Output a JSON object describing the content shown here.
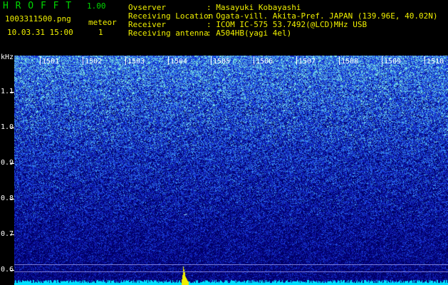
{
  "header": {
    "app_title": "H R O F F T",
    "version": "1.00",
    "filename": "1003311500.png",
    "datetime": "10.03.31 15:00",
    "meteor_label": "meteor",
    "meteor_count": "1",
    "info_labels": [
      "Ovserver",
      "Receiving Location",
      "Receiver",
      "Receiving antenna"
    ],
    "info_values": [
      ": Masayuki Kobayashi",
      ": Ogata-vill. Akita-Pref. JAPAN (139.96E, 40.02N)",
      ": ICOM IC-575 53.7492(@LCD)MHz USB",
      ": A504HB(yagi 4el)"
    ]
  },
  "spectrogram": {
    "unit_label": "kHz",
    "time_ticks": [
      "1501",
      "1502",
      "1503",
      "1504",
      "1505",
      "1506",
      "1507",
      "1508",
      "1509",
      "1510"
    ],
    "freq_ticks": [
      "1.1",
      "1.0",
      "0.9",
      "0.8",
      "0.7",
      "0.6"
    ],
    "meteor_minute": "1504",
    "colors": {
      "background": "#000064",
      "noise_low": "#1b2ed0",
      "noise_high": "#7fe0e0",
      "meteor": "#f0f000",
      "floor": "#00e0ff"
    }
  }
}
